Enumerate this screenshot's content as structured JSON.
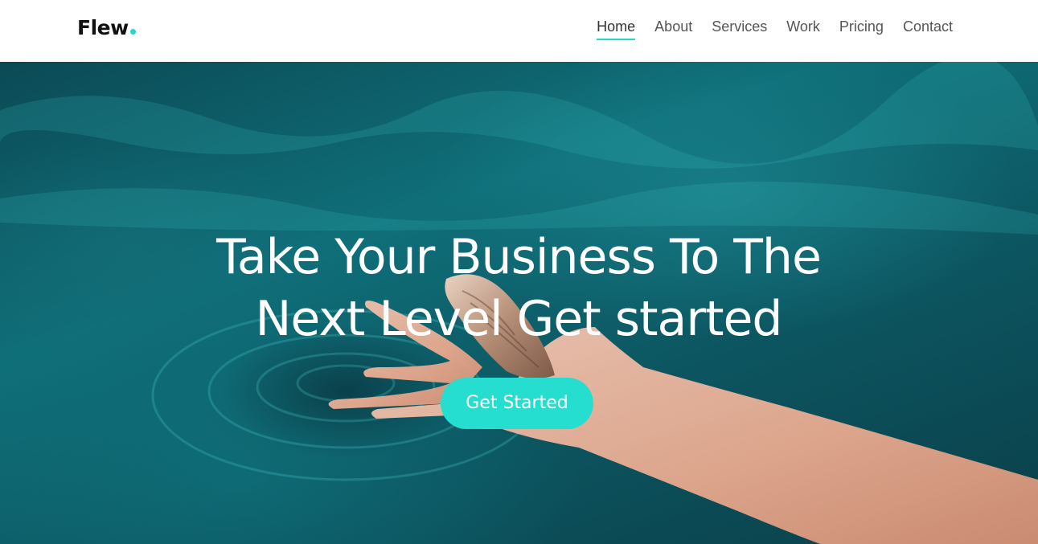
{
  "brand": {
    "name": "Flew",
    "accent_color": "#26d7c8"
  },
  "nav": {
    "items": [
      {
        "label": "Home",
        "active": true
      },
      {
        "label": "About",
        "active": false
      },
      {
        "label": "Services",
        "active": false
      },
      {
        "label": "Work",
        "active": false
      },
      {
        "label": "Pricing",
        "active": false
      },
      {
        "label": "Contact",
        "active": false
      }
    ]
  },
  "hero": {
    "title_line1": "Take Your Business To The",
    "title_line2": "Next Level Get started",
    "cta_label": "Get Started",
    "cta_color": "#26ded0",
    "background_image": "hand-holding-seashell-in-water"
  }
}
